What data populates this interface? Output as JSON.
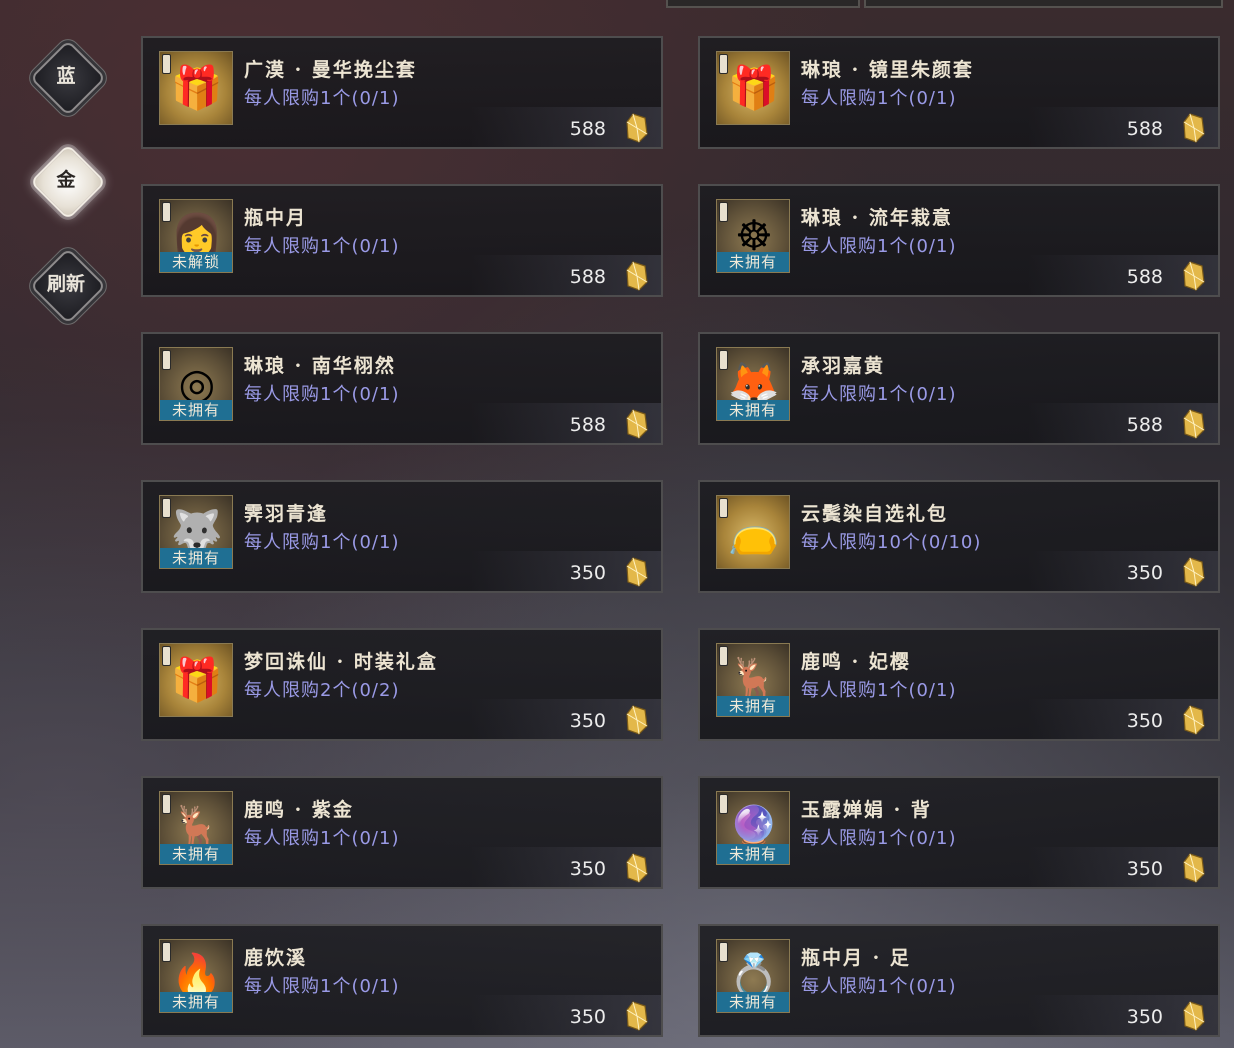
{
  "tabs": [
    {
      "label": "蓝",
      "active": false
    },
    {
      "label": "金",
      "active": true
    },
    {
      "label": "刷新",
      "active": false
    }
  ],
  "items": [
    {
      "title": "广漠 · 曼华挽尘套",
      "limit": "每人限购1个(0/1)",
      "price": "588",
      "tag": "",
      "icon": "gift-box-icon"
    },
    {
      "title": "琳琅 · 镜里朱颜套",
      "limit": "每人限购1个(0/1)",
      "price": "588",
      "tag": "",
      "icon": "gift-box-icon"
    },
    {
      "title": "瓶中月",
      "limit": "每人限购1个(0/1)",
      "price": "588",
      "tag": "未解锁",
      "icon": "portrait-icon"
    },
    {
      "title": "琳琅 · 流年栽意",
      "limit": "每人限购1个(0/1)",
      "price": "588",
      "tag": "未拥有",
      "icon": "ring-icon"
    },
    {
      "title": "琳琅 · 南华栩然",
      "limit": "每人限购1个(0/1)",
      "price": "588",
      "tag": "未拥有",
      "icon": "spirit-ring-icon"
    },
    {
      "title": "承羽嘉黄",
      "limit": "每人限购1个(0/1)",
      "price": "588",
      "tag": "未拥有",
      "icon": "white-fox-icon"
    },
    {
      "title": "霁羽青逢",
      "limit": "每人限购1个(0/1)",
      "price": "350",
      "tag": "未拥有",
      "icon": "wolf-icon"
    },
    {
      "title": "云鬓染自选礼包",
      "limit": "每人限购10个(0/10)",
      "price": "350",
      "tag": "",
      "icon": "red-pouch-icon"
    },
    {
      "title": "梦回诛仙 · 时装礼盒",
      "limit": "每人限购2个(0/2)",
      "price": "350",
      "tag": "",
      "icon": "gift-box-icon"
    },
    {
      "title": "鹿鸣 · 妃樱",
      "limit": "每人限购1个(0/1)",
      "price": "350",
      "tag": "未拥有",
      "icon": "deer-icon"
    },
    {
      "title": "鹿鸣 · 紫金",
      "limit": "每人限购1个(0/1)",
      "price": "350",
      "tag": "未拥有",
      "icon": "purple-deer-icon"
    },
    {
      "title": "玉露婵娟 · 背",
      "limit": "每人限购1个(0/1)",
      "price": "350",
      "tag": "未拥有",
      "icon": "jade-orb-icon"
    },
    {
      "title": "鹿饮溪",
      "limit": "每人限购1个(0/1)",
      "price": "350",
      "tag": "未拥有",
      "icon": "white-flame-icon"
    },
    {
      "title": "瓶中月 · 足",
      "limit": "每人限购1个(0/1)",
      "price": "350",
      "tag": "未拥有",
      "icon": "anklet-icon"
    }
  ],
  "colors": {
    "limit_text": "#9a9ae6",
    "tag_bg": "#1f6f93",
    "coin": "#e3b84a"
  }
}
